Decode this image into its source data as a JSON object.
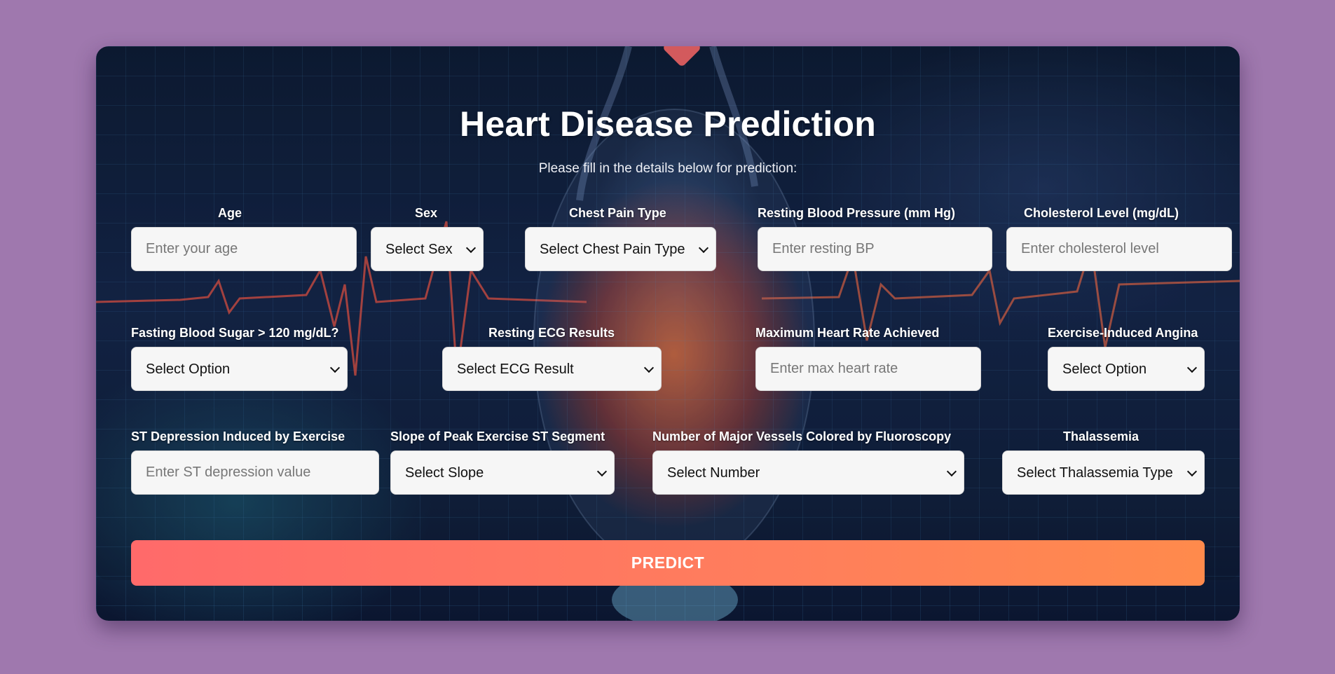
{
  "header": {
    "title": "Heart Disease Prediction",
    "subtitle": "Please fill in the details below for prediction:"
  },
  "fields": {
    "age": {
      "label": "Age",
      "placeholder": "Enter your age"
    },
    "sex": {
      "label": "Sex",
      "selected": "Select Sex"
    },
    "chest_pain": {
      "label": "Chest Pain Type",
      "selected": "Select Chest Pain Type"
    },
    "resting_bp": {
      "label": "Resting Blood Pressure (mm Hg)",
      "placeholder": "Enter resting BP"
    },
    "cholesterol": {
      "label": "Cholesterol Level (mg/dL)",
      "placeholder": "Enter cholesterol level"
    },
    "fasting_sugar": {
      "label": "Fasting Blood Sugar > 120 mg/dL?",
      "selected": "Select Option"
    },
    "resting_ecg": {
      "label": "Resting ECG Results",
      "selected": "Select ECG Result"
    },
    "max_hr": {
      "label": "Maximum Heart Rate Achieved",
      "placeholder": "Enter max heart rate"
    },
    "angina": {
      "label": "Exercise-Induced Angina",
      "selected": "Select Option"
    },
    "st_depression": {
      "label": "ST Depression Induced by Exercise",
      "placeholder": "Enter ST depression value"
    },
    "slope": {
      "label": "Slope of Peak Exercise ST Segment",
      "selected": "Select Slope"
    },
    "vessels": {
      "label": "Number of Major Vessels Colored by Fluoroscopy",
      "selected": "Select Number"
    },
    "thalassemia": {
      "label": "Thalassemia",
      "selected": "Select Thalassemia Type"
    }
  },
  "predict_button": {
    "label": "PREDICT"
  },
  "colors": {
    "page_background": "#9f78ae",
    "button_gradient_start": "#ff6a6a",
    "button_gradient_end": "#ff8a4c",
    "heart_accent": "#ff6b6b"
  }
}
